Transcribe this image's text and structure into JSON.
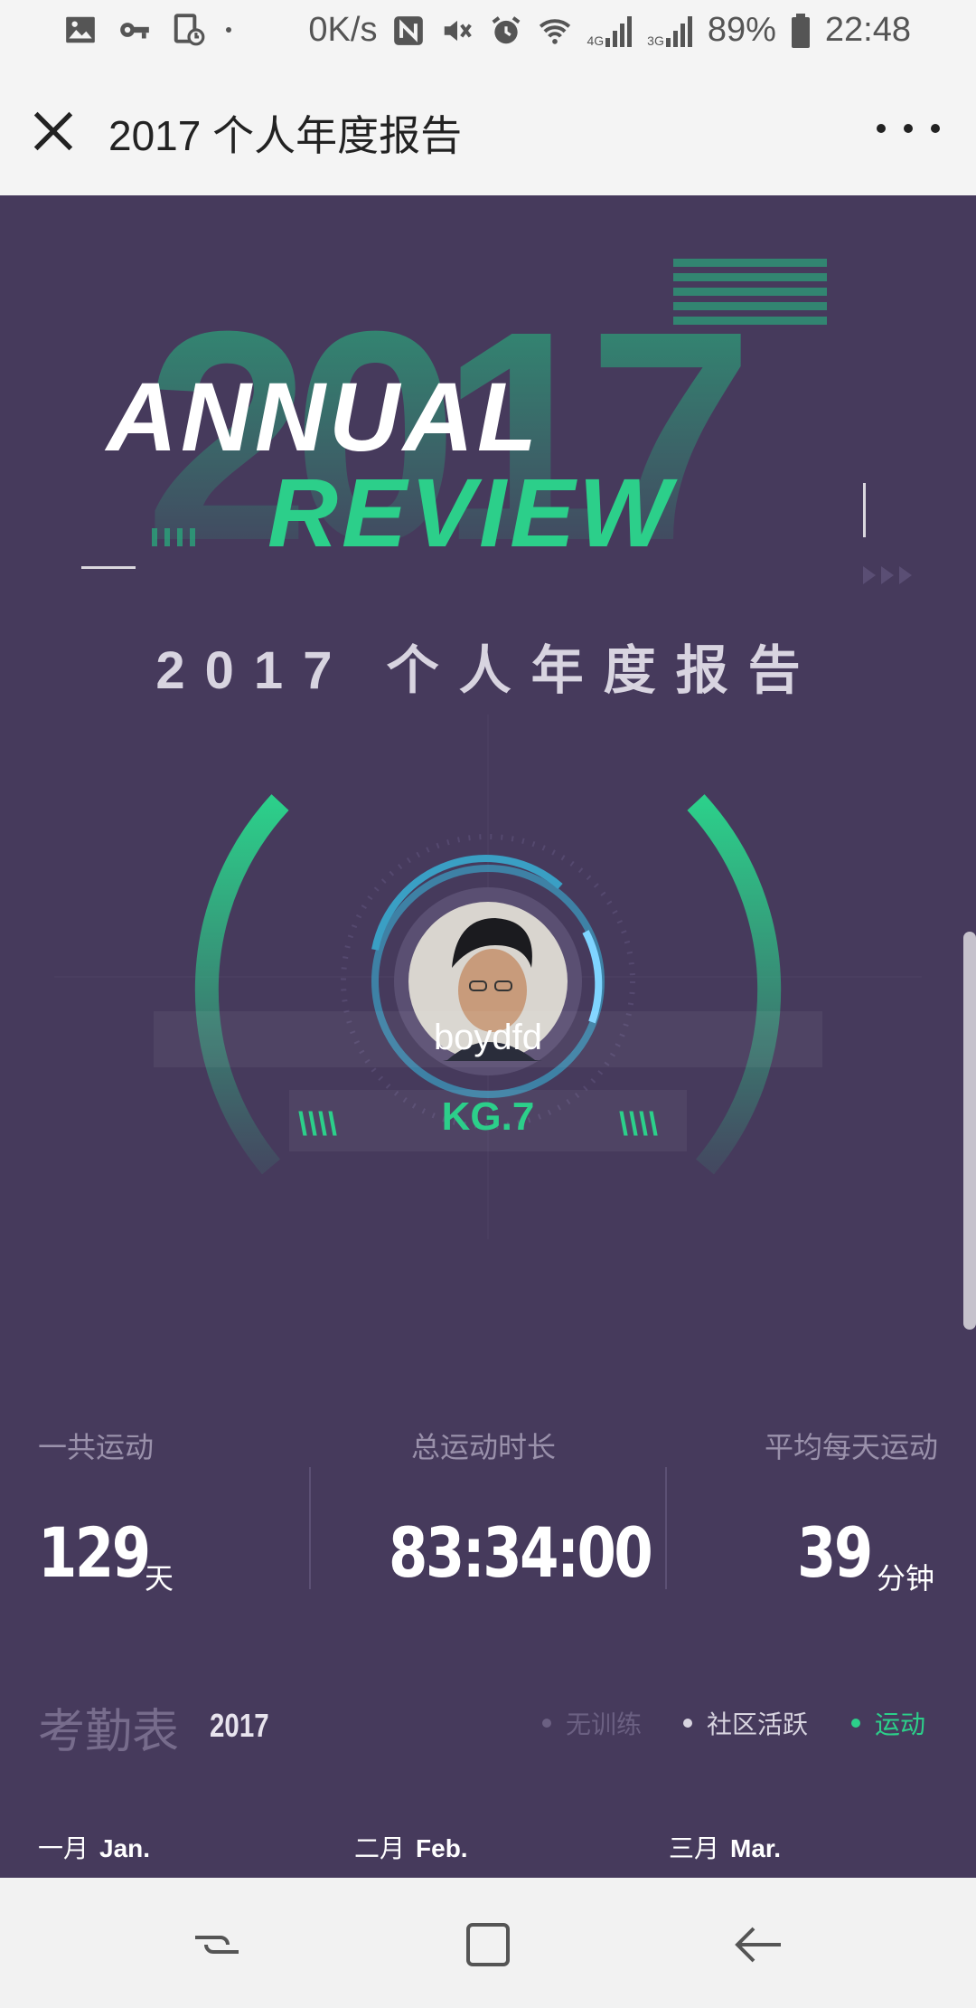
{
  "status_bar": {
    "speed": "0K/s",
    "network_4g": "4G",
    "network_3g": "3G",
    "battery": "89%",
    "time": "22:48",
    "left_icons": [
      "image-icon",
      "key-icon",
      "screen-record-icon",
      "dot-icon"
    ],
    "right_icons": [
      "nfc-icon",
      "mute-icon",
      "alarm-icon",
      "wifi-icon",
      "signal-icon",
      "signal-icon",
      "battery-icon"
    ]
  },
  "navbar": {
    "title": "2017 个人年度报告"
  },
  "hero": {
    "big_year": "2017",
    "word1": "ANNUAL",
    "word2": "REVIEW",
    "report_title": "2017 个人年度报告"
  },
  "profile": {
    "username": "boydfd",
    "level": "KG.7"
  },
  "stats": {
    "total_days_label": "一共运动",
    "total_days_value": "129",
    "total_days_unit": "天",
    "total_time_label": "总运动时长",
    "total_time_value": "83:34:00",
    "avg_label": "平均每天运动",
    "avg_value": "39",
    "avg_unit": "分钟"
  },
  "attendance": {
    "title": "考勤表",
    "year": "2017",
    "legend": [
      {
        "label": "无训练",
        "color": "#6b6082"
      },
      {
        "label": "社区活跃",
        "color": "#d8d4e0"
      },
      {
        "label": "运动",
        "color": "#2ccf8a"
      }
    ],
    "months": [
      {
        "cn": "一月",
        "en": "Jan."
      },
      {
        "cn": "二月",
        "en": "Feb."
      },
      {
        "cn": "三月",
        "en": "Mar."
      }
    ]
  },
  "colors": {
    "accent": "#2ccf8a",
    "background": "#463a5c",
    "ring_blue": "#3a9fc4"
  }
}
